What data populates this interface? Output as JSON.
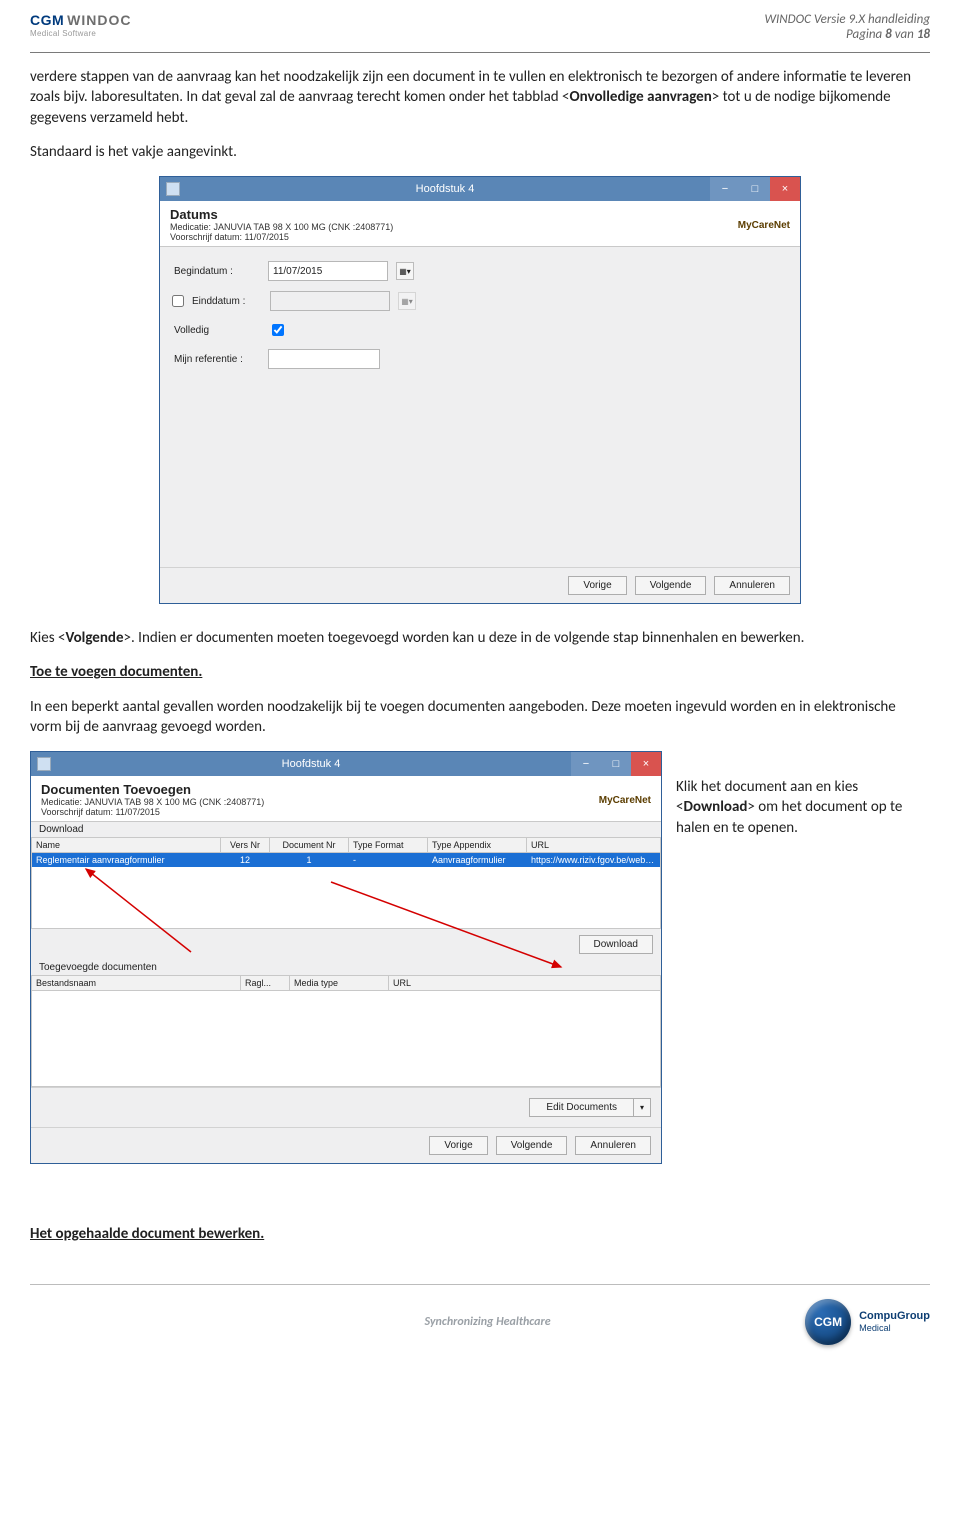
{
  "header": {
    "logo_a": "CGM",
    "logo_b": "WINDOC",
    "logo_sub": "Medical Software",
    "right_line1": "WINDOC Versie 9.X handleiding",
    "right_line2_a": "Pagina ",
    "right_line2_b": "8",
    "right_line2_c": " van ",
    "right_line2_d": "18"
  },
  "para1_a": "verdere stappen van de aanvraag kan het noodzakelijk zijn een document in te vullen en elektronisch te bezorgen of andere informatie te leveren zoals bijv. laboresultaten. In dat geval zal de aanvraag terecht komen onder het tabblad <",
  "para1_b": "Onvolledige aanvragen",
  "para1_c": "> tot u de nodige bijkomende gegevens verzameld hebt.",
  "para2": "Standaard is het vakje aangevinkt.",
  "win1": {
    "title": "Hoofdstuk 4",
    "heading": "Datums",
    "sub1": "Medicatie: JANUVIA TAB 98 X 100 MG (CNK :2408771)",
    "sub2": "Voorschrijf datum: 11/07/2015",
    "brand": "MyCareNet",
    "lbl_begin": "Begindatum :",
    "val_begin": "11/07/2015",
    "lbl_eind": "Einddatum :",
    "lbl_volledig": "Volledig",
    "lbl_ref": "Mijn referentie :",
    "btn_prev": "Vorige",
    "btn_next": "Volgende",
    "btn_cancel": "Annuleren"
  },
  "para3_a": "Kies <",
  "para3_b": "Volgende",
  "para3_c": ">. Indien er documenten moeten toegevoegd worden kan u deze in de volgende stap binnenhalen en bewerken.",
  "heading2": "Toe te voegen documenten.",
  "para4": "In een beperkt aantal gevallen worden noodzakelijk bij te voegen documenten aangeboden. Deze moeten ingevuld worden en in elektronische vorm bij de aanvraag gevoegd worden.",
  "win2": {
    "title": "Hoofdstuk 4",
    "heading": "Documenten Toevoegen",
    "sub1": "Medicatie: JANUVIA TAB 98 X 100 MG (CNK :2408771)",
    "sub2": "Voorschrijf datum: 11/07/2015",
    "brand": "MyCareNet",
    "group1": "Download",
    "cols": {
      "name": "Name",
      "vers": "Vers Nr",
      "docnr": "Document Nr",
      "tf": "Type Format",
      "ta": "Type Appendix",
      "url": "URL"
    },
    "row": {
      "name": "Reglementair aanvraagformulier",
      "vers": "12",
      "docnr": "1",
      "tf": "-",
      "ta": "Aanvraagformulier",
      "url": "https://www.riziv.fgov.be/webprd/appl/pssp/..."
    },
    "btn_dl": "Download",
    "group2": "Toegevoegde documenten",
    "cols2": {
      "bestand": "Bestandsnaam",
      "ragl": "Ragl...",
      "media": "Media type",
      "url": "URL"
    },
    "btn_edit": "Edit Documents",
    "btn_prev": "Vorige",
    "btn_next": "Volgende",
    "btn_cancel": "Annuleren"
  },
  "side_a": "Klik het document aan en kies <",
  "side_b": "Download",
  "side_c": "> om het document op te halen en te openen.",
  "heading3": "Het opgehaalde document bewerken.",
  "footer": {
    "sync": "Synchronizing Healthcare",
    "cgm": "CGM",
    "cgm_text_a": "CompuGroup",
    "cgm_text_b": "Medical"
  }
}
